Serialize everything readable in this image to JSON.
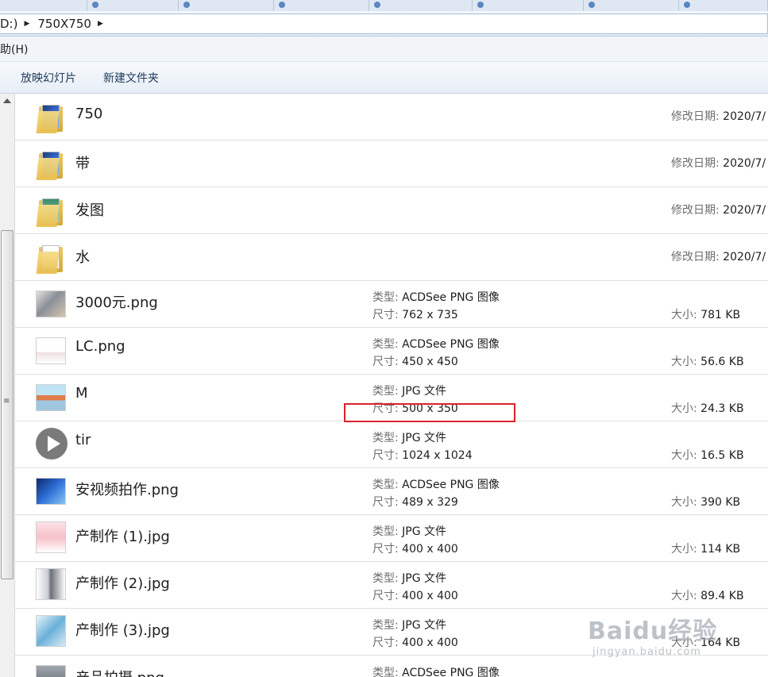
{
  "address": {
    "segments": [
      "D:)",
      "750X750"
    ]
  },
  "menu": {
    "help_label": "帮助(H)"
  },
  "toolbar": {
    "slideshow_label": "放映幻灯片",
    "new_folder_label": "新建文件夹"
  },
  "labels": {
    "type": "类型:",
    "dims": "尺寸:",
    "size": "大小:",
    "modified": "修改日期:"
  },
  "files": [
    {
      "kind": "folder",
      "name": "750",
      "modified": "2020/7/"
    },
    {
      "kind": "folder",
      "name": "带",
      "modified": "2020/7/"
    },
    {
      "kind": "folder",
      "name": "发图",
      "modified": "2020/7/"
    },
    {
      "kind": "folder",
      "name": "水",
      "modified": "2020/7/"
    },
    {
      "kind": "image",
      "name": "3000元.png",
      "type": "ACDSee PNG 图像",
      "dims": "762 x 735",
      "size": "781 KB"
    },
    {
      "kind": "image",
      "name": "LC.png",
      "type": "ACDSee PNG 图像",
      "dims": "450 x 450",
      "size": "56.6 KB"
    },
    {
      "kind": "image",
      "name": "M",
      "type": "JPG 文件",
      "dims": "500 x 350",
      "size": "24.3 KB"
    },
    {
      "kind": "video",
      "name": "tir",
      "type": "JPG 文件",
      "dims": "1024 x 1024",
      "size": "16.5 KB"
    },
    {
      "kind": "image",
      "name": "安视频拍作.png",
      "type": "ACDSee PNG 图像",
      "dims": "489 x 329",
      "size": "390 KB"
    },
    {
      "kind": "image",
      "name": "产制作 (1).jpg",
      "type": "JPG 文件",
      "dims": "400 x 400",
      "size": "114 KB"
    },
    {
      "kind": "image",
      "name": "产制作 (2).jpg",
      "type": "JPG 文件",
      "dims": "400 x 400",
      "size": "89.4 KB"
    },
    {
      "kind": "image",
      "name": "产制作 (3).jpg",
      "type": "JPG 文件",
      "dims": "400 x 400",
      "size": "164 KB"
    },
    {
      "kind": "image",
      "name": "产品拍摄.png",
      "type": "ACDSee PNG 图像",
      "dims": "",
      "size": ""
    }
  ],
  "watermark": {
    "main": "Baidu经验",
    "sub": "jingyan.baidu.com"
  },
  "colors": {
    "highlight": "#d9232b",
    "toolbar_text": "#1e395b"
  }
}
